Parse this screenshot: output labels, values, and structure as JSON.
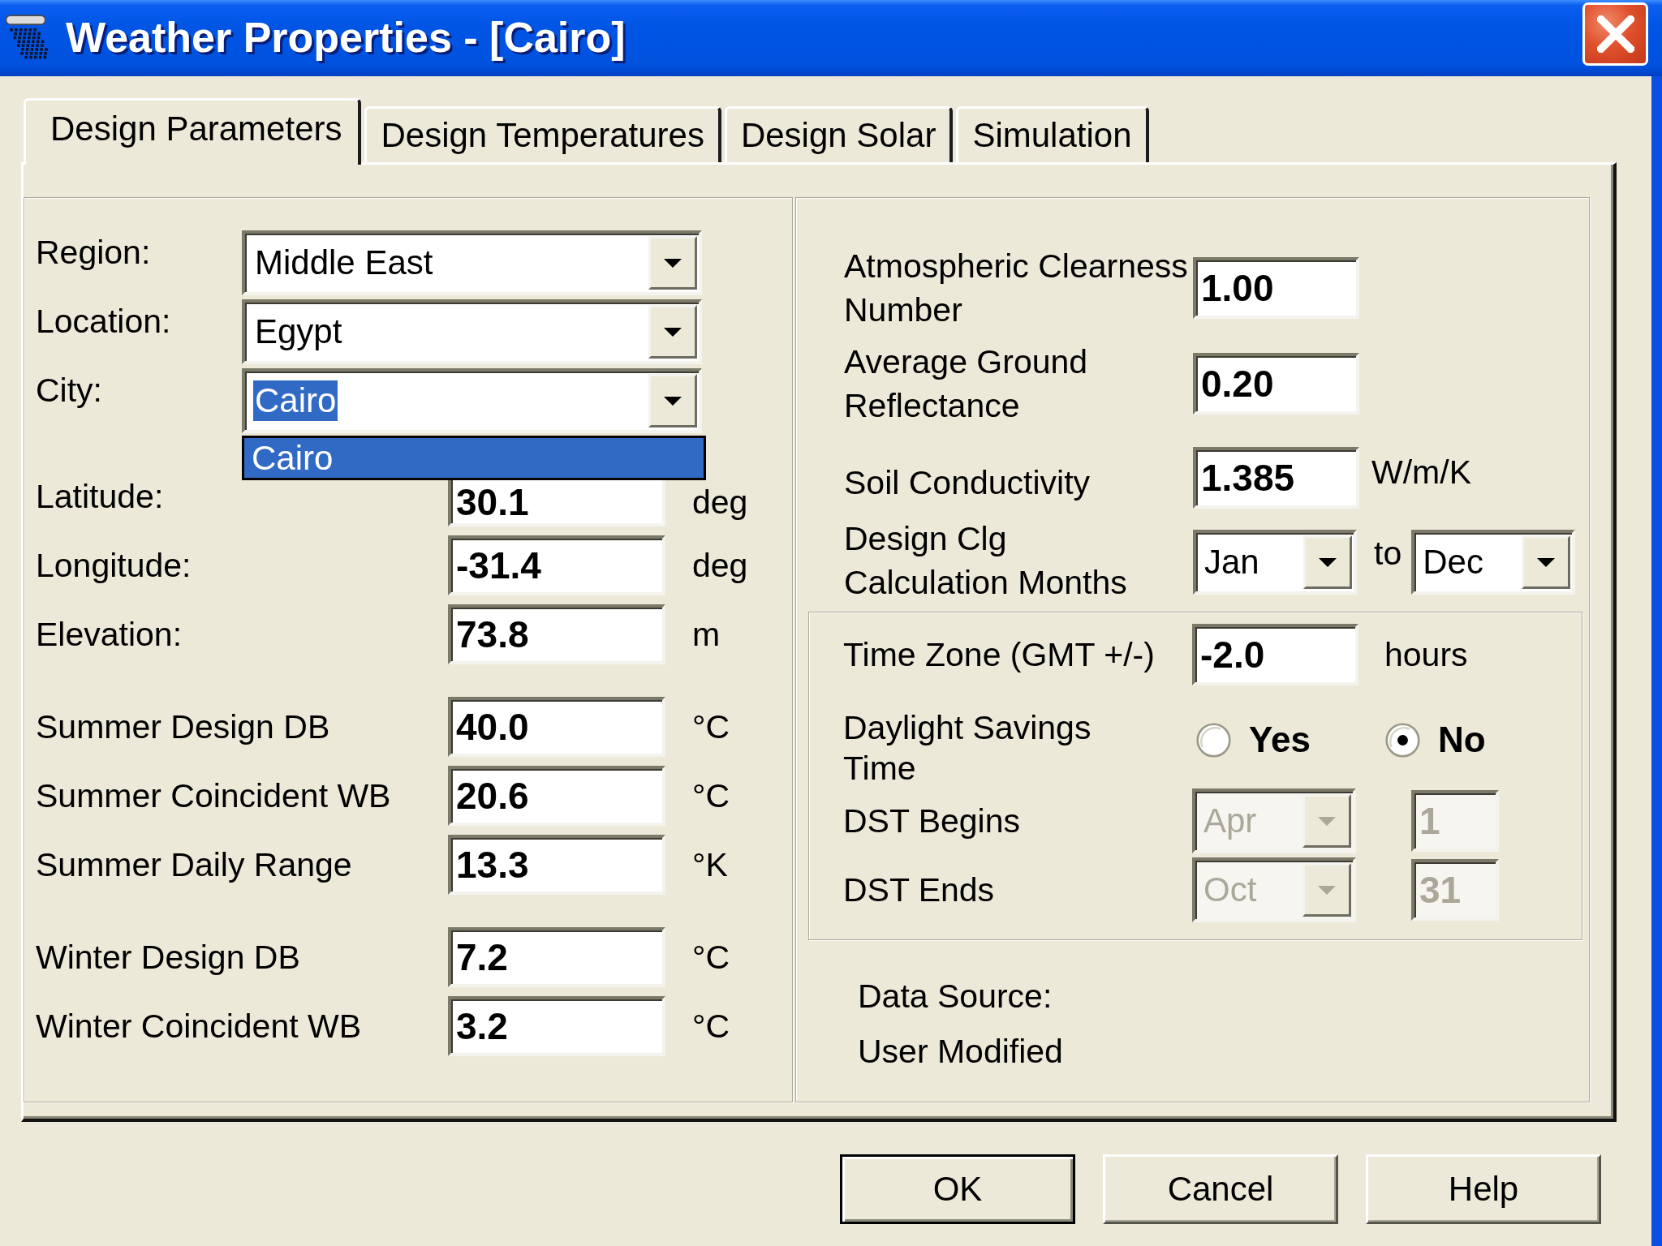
{
  "window": {
    "title": "Weather Properties - [Cairo]"
  },
  "tabs": [
    {
      "label": "Design Parameters",
      "selected": true
    },
    {
      "label": "Design Temperatures",
      "selected": false
    },
    {
      "label": "Design Solar",
      "selected": false
    },
    {
      "label": "Simulation",
      "selected": false
    }
  ],
  "location": {
    "selectors": [
      {
        "label": "Region:",
        "value": "Middle East",
        "text_highlighted": false
      },
      {
        "label": "Location:",
        "value": "Egypt",
        "text_highlighted": false
      },
      {
        "label": "City:",
        "value": "Cairo",
        "text_highlighted": true,
        "open_list": [
          {
            "label": "Cairo",
            "selected": true
          }
        ]
      }
    ],
    "field_groups": [
      {
        "fields": [
          {
            "label": "Latitude:",
            "value": "30.1",
            "unit": "deg"
          },
          {
            "label": "Longitude:",
            "value": "-31.4",
            "unit": "deg"
          },
          {
            "label": "Elevation:",
            "value": "73.8",
            "unit": "m"
          }
        ]
      },
      {
        "fields": [
          {
            "label": "Summer Design DB",
            "value": "40.0",
            "unit": "°C"
          },
          {
            "label": "Summer Coincident WB",
            "value": "20.6",
            "unit": "°C"
          },
          {
            "label": "Summer Daily Range",
            "value": "13.3",
            "unit": "°K"
          }
        ]
      },
      {
        "fields": [
          {
            "label": "Winter Design DB",
            "value": "7.2",
            "unit": "°C"
          },
          {
            "label": "Winter Coincident WB",
            "value": "3.2",
            "unit": "°C"
          }
        ]
      }
    ]
  },
  "site": {
    "fields": [
      {
        "label": "Atmospheric Clearness\nNumber",
        "value": "1.00"
      },
      {
        "label": "Average Ground\nReflectance",
        "value": "0.20"
      },
      {
        "label": "Soil Conductivity",
        "value": "1.385",
        "unit": "W/m/K"
      }
    ],
    "cooling_months": {
      "label": "Design Clg\nCalculation Months",
      "from": "Jan",
      "separator": "to",
      "to": "Dec"
    },
    "daylight_group": {
      "time_zone": {
        "label": "Time Zone (GMT +/-)",
        "value": "-2.0",
        "unit": "hours"
      },
      "daylight_savings": {
        "label": "Daylight Savings\nTime",
        "options": [
          {
            "label": "Yes",
            "selected": false
          },
          {
            "label": "No",
            "selected": true
          }
        ]
      },
      "dst": [
        {
          "label": "DST Begins",
          "month": "Apr",
          "day": "1",
          "disabled": true
        },
        {
          "label": "DST Ends",
          "month": "Oct",
          "day": "31",
          "disabled": true
        }
      ]
    },
    "data_source": {
      "label": "Data Source:",
      "value": "User Modified"
    }
  },
  "buttons": [
    {
      "label": "OK",
      "default": true
    },
    {
      "label": "Cancel",
      "default": false
    },
    {
      "label": "Help",
      "default": false
    }
  ]
}
